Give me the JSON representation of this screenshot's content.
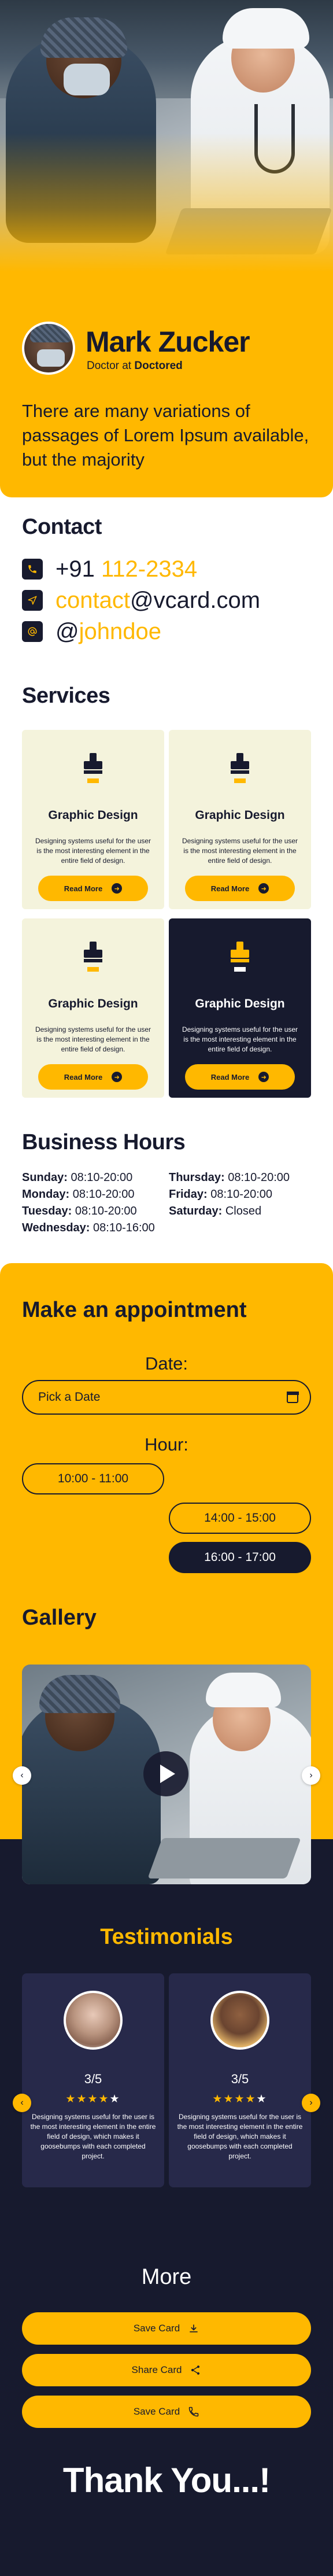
{
  "profile": {
    "name": "Mark Zucker",
    "role_prefix": "Doctor at",
    "company": "Doctored",
    "bio": "There are many variations of passages of Lorem Ipsum available, but the majority"
  },
  "contact": {
    "title": "Contact",
    "phone_prefix": "+91",
    "phone_number": "112-2334",
    "email_user": "contact",
    "email_domain": "@vcard.com",
    "handle_at": "@",
    "handle_name": "johndoe",
    "icons": [
      "phone-icon",
      "send-icon",
      "at-icon"
    ]
  },
  "services": {
    "title": "Services",
    "items": [
      {
        "title": "Graphic Design",
        "desc": "Designing systems useful for the user is the most interesting element in the entire field of design.",
        "button": "Read More",
        "highlighted": false
      },
      {
        "title": "Graphic Design",
        "desc": "Designing systems useful for the user is the most interesting element in the entire field of design.",
        "button": "Read More",
        "highlighted": false
      },
      {
        "title": "Graphic Design",
        "desc": "Designing systems useful for the user is the most interesting element in the entire field of design.",
        "button": "Read More",
        "highlighted": false
      },
      {
        "title": "Graphic Design",
        "desc": "Designing systems useful for the user is the most interesting element in the entire field of design.",
        "button": "Read More",
        "highlighted": true
      }
    ]
  },
  "hours": {
    "title": "Business Hours",
    "left": [
      {
        "day": "Sunday:",
        "time": "08:10-20:00"
      },
      {
        "day": "Monday:",
        "time": "08:10-20:00"
      },
      {
        "day": "Tuesday:",
        "time": "08:10-20:00"
      },
      {
        "day": "Wednesday:",
        "time": "08:10-16:00"
      }
    ],
    "right": [
      {
        "day": "Thursday:",
        "time": "08:10-20:00"
      },
      {
        "day": "Friday:",
        "time": "08:10-20:00"
      },
      {
        "day": "Saturday:",
        "time": "Closed"
      }
    ]
  },
  "appointment": {
    "title": "Make an appointment",
    "date_label": "Date:",
    "date_placeholder": "Pick a Date",
    "hour_label": "Hour:",
    "slots": [
      "10:00 - 11:00",
      "14:00 - 15:00",
      "16:00 - 17:00"
    ],
    "selected_slot": "16:00 - 17:00"
  },
  "gallery": {
    "title": "Gallery"
  },
  "testimonials": {
    "title": "Testimonials",
    "items": [
      {
        "score": "3/5",
        "rating": 4,
        "text": "Designing systems useful for the user is the most interesting element in the entire field of design, which makes it goosebumps with each completed project."
      },
      {
        "score": "3/5",
        "rating": 4,
        "text": "Designing systems useful for the user is the most interesting element in the entire field of design, which makes it goosebumps with each completed project."
      }
    ]
  },
  "more": {
    "title": "More",
    "buttons": [
      {
        "label": "Save Card",
        "icon": "download-icon"
      },
      {
        "label": "Share Card",
        "icon": "share-icon"
      },
      {
        "label": "Save Card",
        "icon": "phone-icon"
      }
    ]
  },
  "footer": {
    "thanks": "Thank You...!"
  },
  "colors": {
    "accent": "#ffb800",
    "dark": "#171a2e",
    "card_light": "#f4f3dc",
    "card_testimonial": "#27294a"
  }
}
